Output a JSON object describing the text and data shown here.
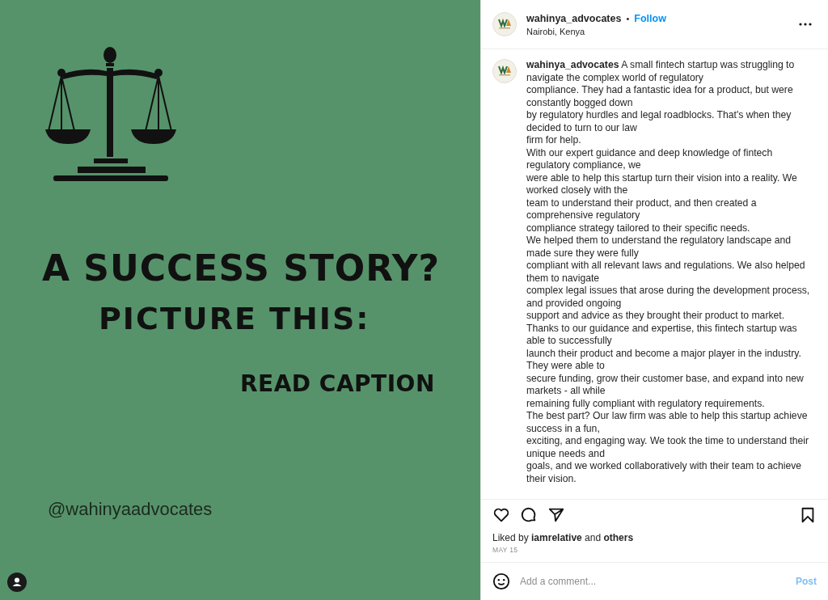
{
  "post_image": {
    "headline": "A SUCCESS STORY?",
    "subheadline": "PICTURE THIS:",
    "call_to_action": "READ CAPTION",
    "handle": "@wahinyaadvocates"
  },
  "header": {
    "username": "wahinya_advocates",
    "separator": "•",
    "follow": "Follow",
    "location": "Nairobi, Kenya"
  },
  "caption": "**wahinya_advocates** A small fintech startup was struggling to navigate the complex world of regulatory\ncompliance. They had a fantastic idea for a product, but were constantly bogged down\nby regulatory hurdles and legal roadblocks. That's when they decided to turn to our law\nfirm for help.\nWith our expert guidance and deep knowledge of fintech regulatory compliance, we\nwere able to help this startup turn their vision into a reality. We worked closely with the\nteam to understand their product, and then created a comprehensive regulatory\ncompliance strategy tailored to their specific needs.\nWe helped them to understand the regulatory landscape and made sure they were fully\ncompliant with all relevant laws and regulations. We also helped them to navigate\ncomplex legal issues that arose during the development process, and provided ongoing\nsupport and advice as they brought their product to market.\nThanks to our guidance and expertise, this fintech startup was able to successfully\nlaunch their product and become a major player in the industry. They were able to\nsecure funding, grow their customer base, and expand into new markets - all while\nremaining fully compliant with regulatory requirements.\nThe best part? Our law firm was able to help this startup achieve success in a fun,\nexciting, and engaging way. We took the time to understand their unique needs and\ngoals, and we worked collaboratively with their team to achieve their vision.",
  "likes": "Liked by **iamrelative** and **others**",
  "date": "MAY 15",
  "comment": {
    "placeholder": "Add a comment...",
    "post_button": {
      "label": "Post",
      "disabled": true
    }
  }
}
